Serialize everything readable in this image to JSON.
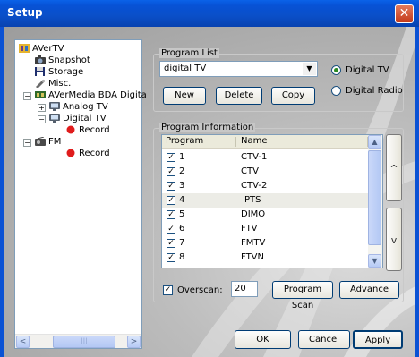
{
  "window": {
    "title": "Setup",
    "close_glyph": "✕"
  },
  "tree": {
    "items": [
      {
        "label": "AVerTV",
        "icon": "avertv-icon"
      },
      {
        "label": "Snapshot",
        "icon": "camera-icon"
      },
      {
        "label": "Storage",
        "icon": "floppy-icon"
      },
      {
        "label": "Misc.",
        "icon": "wrench-icon"
      },
      {
        "label": "AVerMedia BDA Digita",
        "icon": "device-icon"
      },
      {
        "label": "Analog TV",
        "icon": "tv-icon"
      },
      {
        "label": "Digital TV",
        "icon": "tv-icon"
      },
      {
        "label": "Record",
        "icon": "record-icon"
      },
      {
        "label": "FM",
        "icon": "radio-icon"
      },
      {
        "label": "Record",
        "icon": "record-icon"
      }
    ],
    "scroll_left": "<",
    "scroll_right": ">",
    "scroll_thumb": "|||"
  },
  "program_list": {
    "legend": "Program List",
    "selected": "digital TV",
    "new_label": "New",
    "delete_label": "Delete",
    "copy_label": "Copy",
    "radio_digital_tv": "Digital TV",
    "radio_digital_radio": "Digital Radio"
  },
  "program_info": {
    "legend": "Program Information",
    "columns": [
      "Program",
      "Name"
    ],
    "rows": [
      {
        "program": "1",
        "name": "CTV-1"
      },
      {
        "program": "2",
        "name": "CTV"
      },
      {
        "program": "3",
        "name": "CTV-2"
      },
      {
        "program": "4",
        "name": "PTS"
      },
      {
        "program": "5",
        "name": "DIMO"
      },
      {
        "program": "6",
        "name": "FTV"
      },
      {
        "program": "7",
        "name": "FMTV"
      },
      {
        "program": "8",
        "name": "FTVN"
      }
    ],
    "up_glyph": "^",
    "down_glyph": "v",
    "overscan_label": "Overscan:",
    "overscan_value": "20",
    "program_scan_label": "Program Scan",
    "advance_label": "Advance"
  },
  "footer": {
    "ok_label": "OK",
    "cancel_label": "Cancel",
    "apply_label": "Apply"
  },
  "colors": {
    "titlebar": "#0a58de",
    "close": "#d35436",
    "frame": "#0b52d4"
  }
}
